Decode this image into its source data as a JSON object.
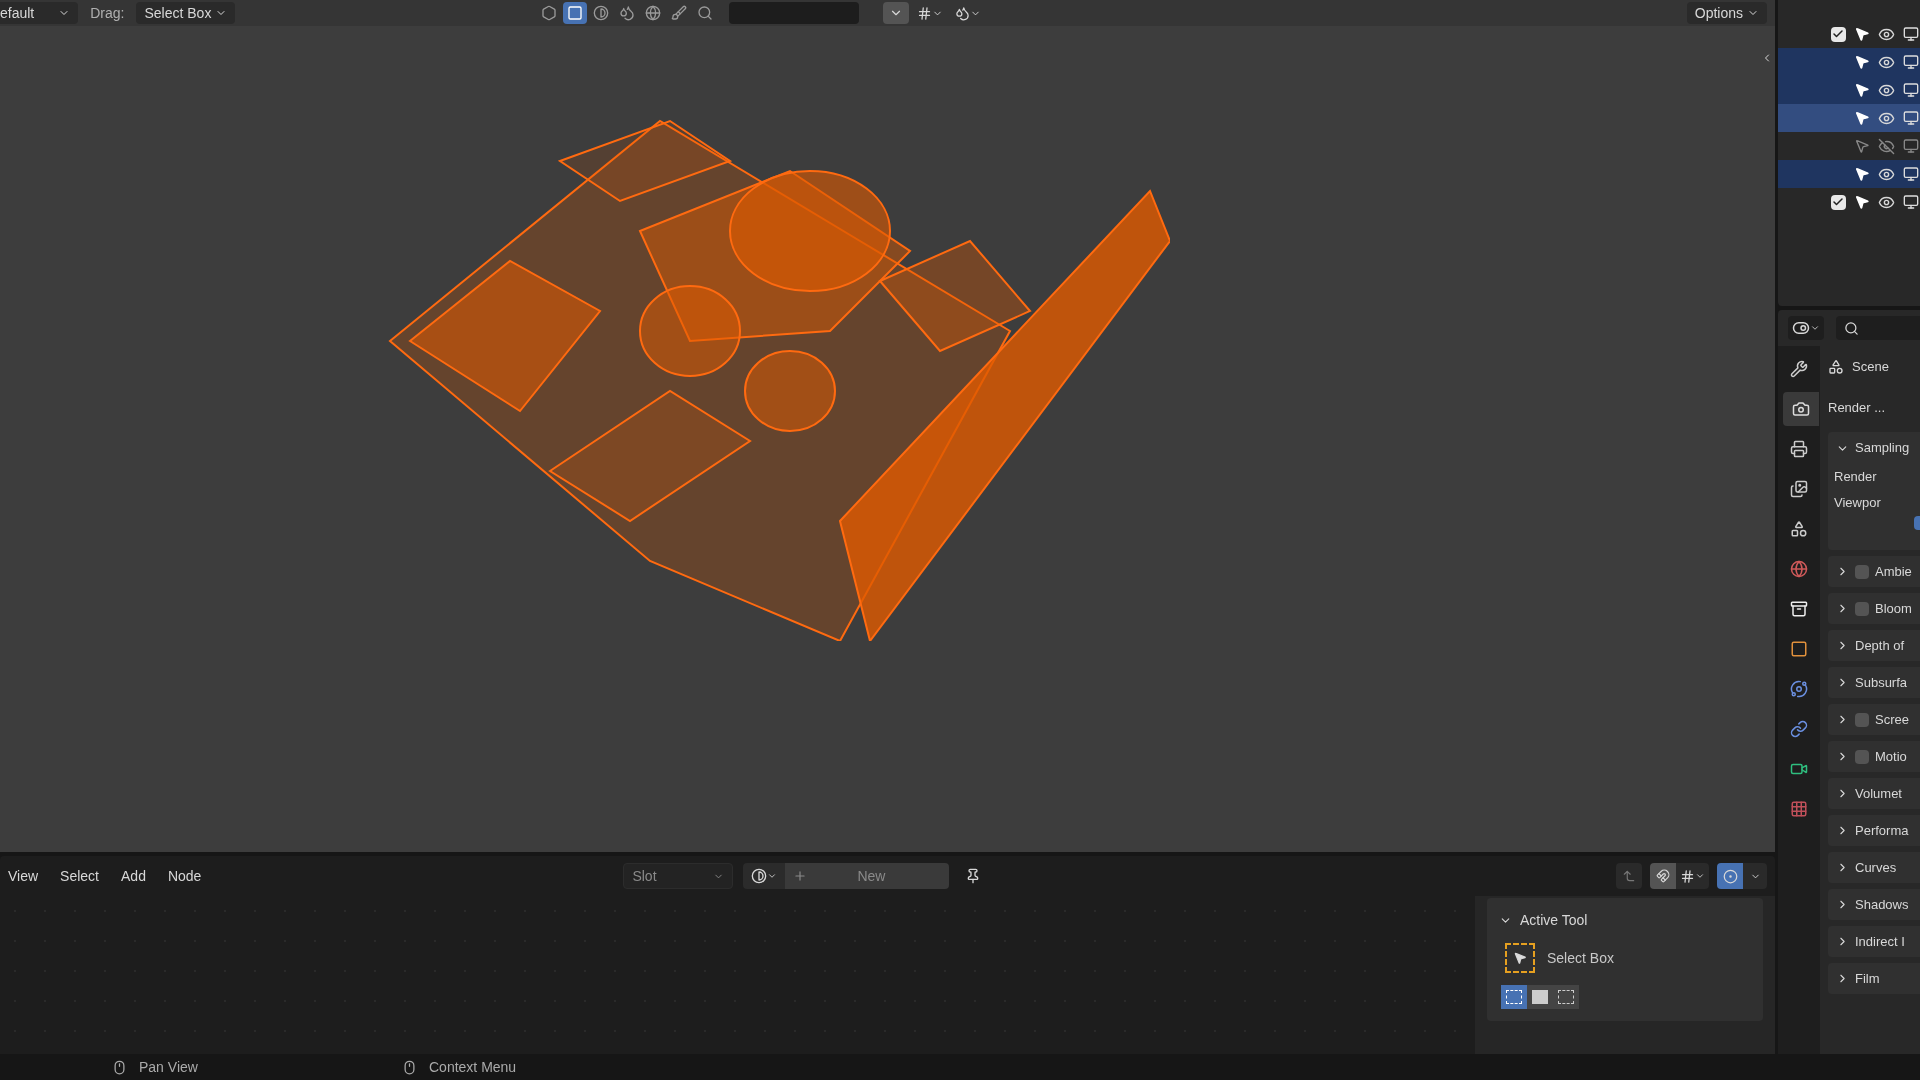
{
  "viewport_header": {
    "mode": "efault",
    "drag_label": "Drag:",
    "drag_value": "Select Box",
    "options": "Options",
    "tools": [
      {
        "kind": "xray",
        "selected": false
      },
      {
        "kind": "select",
        "selected": true
      },
      {
        "kind": "solid",
        "selected": false
      },
      {
        "kind": "material",
        "selected": false
      },
      {
        "kind": "rendered",
        "selected": false
      },
      {
        "kind": "paint",
        "selected": false
      },
      {
        "kind": "search",
        "selected": false
      }
    ]
  },
  "outliner": {
    "rows": [
      {
        "kind": "collection",
        "checked": true,
        "selected": false,
        "active": false,
        "visible": true
      },
      {
        "kind": "object",
        "selected": true,
        "active": false,
        "visible": true
      },
      {
        "kind": "object",
        "selected": true,
        "active": false,
        "visible": true
      },
      {
        "kind": "object",
        "selected": true,
        "active": true,
        "visible": true
      },
      {
        "kind": "object",
        "selected": false,
        "active": false,
        "visible": false
      },
      {
        "kind": "object",
        "selected": true,
        "active": false,
        "visible": true
      },
      {
        "kind": "collection",
        "checked": true,
        "selected": false,
        "active": false,
        "visible": true
      }
    ]
  },
  "properties": {
    "tabs": [
      {
        "kind": "tool",
        "selected": false
      },
      {
        "kind": "render",
        "selected": true
      },
      {
        "kind": "output",
        "selected": false
      },
      {
        "kind": "view_layer",
        "selected": false
      },
      {
        "kind": "scene",
        "selected": false
      },
      {
        "kind": "world",
        "selected": false
      },
      {
        "kind": "collection",
        "selected": false
      },
      {
        "kind": "object",
        "selected": false
      },
      {
        "kind": "physics",
        "selected": false
      },
      {
        "kind": "constraints",
        "selected": false
      },
      {
        "kind": "data",
        "selected": false
      },
      {
        "kind": "texture",
        "selected": false
      }
    ],
    "scene": "Scene",
    "render_label": "Render ...",
    "sampling": {
      "title": "Sampling",
      "expanded": true,
      "rows": [
        "Render",
        "Viewpor"
      ],
      "checked": true
    },
    "panels": [
      {
        "title": "Ambie",
        "kind": "toggle",
        "checked": false
      },
      {
        "title": "Bloom",
        "kind": "toggle",
        "checked": false
      },
      {
        "title": "Depth of",
        "kind": "plain"
      },
      {
        "title": "Subsurfa",
        "kind": "plain"
      },
      {
        "title": "Scree",
        "kind": "toggle",
        "checked": false
      },
      {
        "title": "Motio",
        "kind": "toggle",
        "checked": false
      },
      {
        "title": "Volumet",
        "kind": "plain"
      },
      {
        "title": "Performa",
        "kind": "plain"
      },
      {
        "title": "Curves",
        "kind": "plain"
      },
      {
        "title": "Shadows",
        "kind": "plain"
      },
      {
        "title": "Indirect I",
        "kind": "plain"
      },
      {
        "title": "Film",
        "kind": "plain"
      }
    ]
  },
  "node_editor": {
    "menus": [
      "View",
      "Select",
      "Add",
      "Node"
    ],
    "slot": "Slot",
    "new_button": "New",
    "active_tool": {
      "title": "Active Tool",
      "expanded": true,
      "tool": "Select Box",
      "modes": [
        {
          "kind": "new",
          "selected": true
        },
        {
          "kind": "extend",
          "selected": false
        },
        {
          "kind": "subtract",
          "selected": false
        }
      ]
    }
  },
  "status_bar": [
    {
      "text": "Pan View"
    },
    {
      "text": "Context Menu"
    }
  ]
}
